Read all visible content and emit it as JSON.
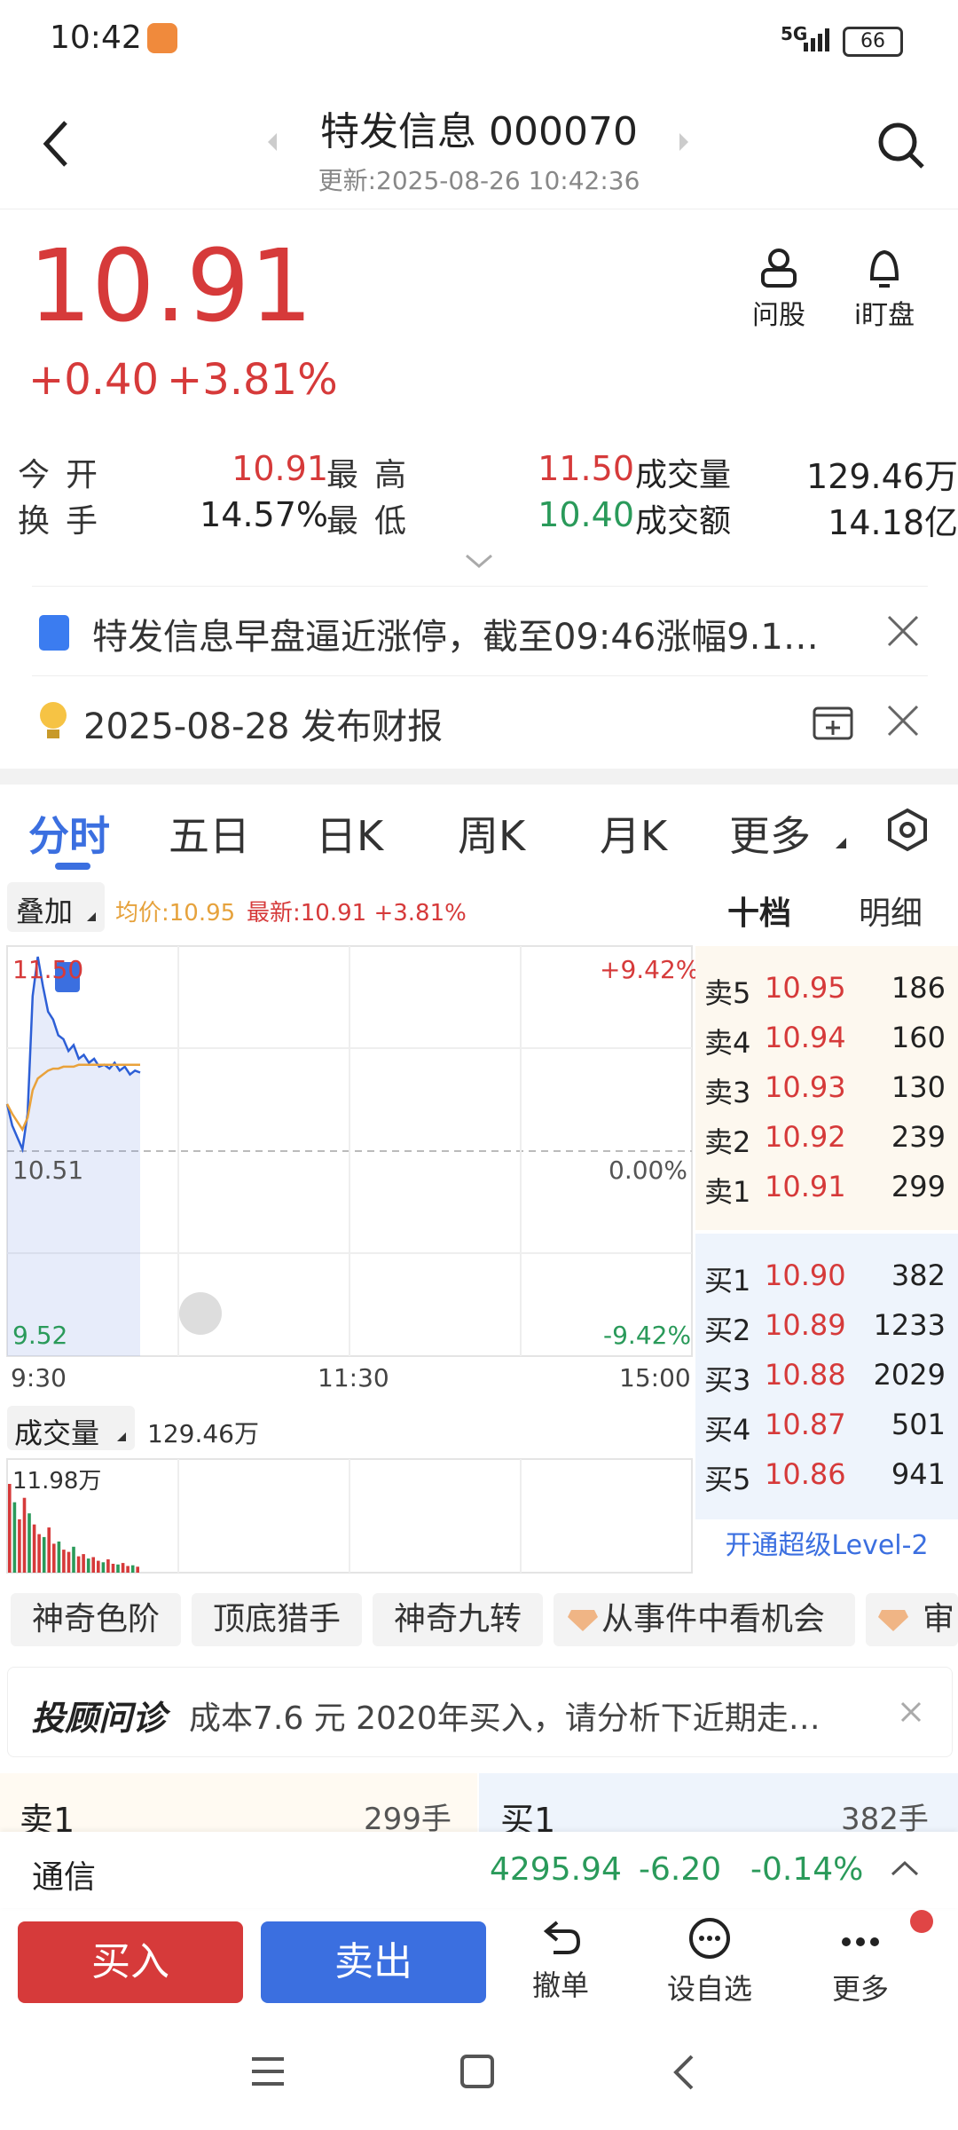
{
  "status": {
    "time": "10:42",
    "network": "5G",
    "battery": "66"
  },
  "header": {
    "title": "特发信息 000070",
    "updated": "更新:2025-08-26 10:42:36"
  },
  "quote": {
    "price": "10.91",
    "change": "+0.40",
    "change_pct": "+3.81%",
    "ask_label": "问股",
    "watch_label": "i盯盘",
    "stats": [
      {
        "label": "今开",
        "value": "10.91",
        "color": "red"
      },
      {
        "label": "最高",
        "value": "11.50",
        "color": "red"
      },
      {
        "label": "成交量",
        "value": "129.46万",
        "color": "black"
      },
      {
        "label": "换手",
        "value": "14.57%",
        "color": "black"
      },
      {
        "label": "最低",
        "value": "10.40",
        "color": "green"
      },
      {
        "label": "成交额",
        "value": "14.18亿",
        "color": "black"
      }
    ]
  },
  "news": {
    "headline": "特发信息早盘逼近涨停，截至09:46涨幅9.1…",
    "event": "2025-08-28 发布财报"
  },
  "tabs": [
    "分时",
    "五日",
    "日K",
    "周K",
    "月K",
    "更多"
  ],
  "chart_toolbar": {
    "overlay": "叠加",
    "avg": "均价:10.95",
    "latest": "最新:10.91 +3.81%",
    "depth_tab": "十档",
    "detail_tab": "明细"
  },
  "chart_labels": {
    "high": "11.50",
    "mid": "10.51",
    "low": "9.52",
    "pct_high": "+9.42%",
    "pct_mid": "0.00%",
    "pct_low": "-9.42%",
    "t_start": "9:30",
    "t_mid": "11:30",
    "t_end": "15:00",
    "vol_label": "成交量",
    "vol_total": "129.46万",
    "vol_max": "11.98万"
  },
  "chart_data": {
    "type": "line",
    "series": [
      {
        "values": [
          10.75,
          10.64,
          10.58,
          10.52,
          10.7,
          11.3,
          11.5,
          11.35,
          11.22,
          11.18,
          11.1,
          11.08,
          11.02,
          11.05,
          10.98,
          11.0,
          10.96,
          10.98,
          10.94,
          10.95,
          10.93,
          10.96,
          10.92,
          10.94,
          10.9,
          10.92,
          10.91
        ]
      },
      {
        "values": [
          10.75,
          10.7,
          10.66,
          10.62,
          10.68,
          10.82,
          10.88,
          10.9,
          10.92,
          10.93,
          10.93,
          10.94,
          10.94,
          10.94,
          10.95,
          10.95,
          10.95,
          10.95,
          10.95,
          10.95,
          10.95,
          10.95,
          10.95,
          10.95,
          10.95,
          10.95,
          10.95
        ]
      }
    ],
    "ylim": [
      9.52,
      11.5
    ],
    "volume": [
      11.98,
      9.5,
      7.2,
      10.1,
      8.0,
      6.5,
      5.2,
      4.8,
      6.1,
      3.9,
      4.2,
      3.1,
      2.8,
      3.5,
      2.2,
      2.5,
      1.9,
      2.1,
      1.6,
      1.4,
      1.8,
      1.2,
      1.1,
      1.3,
      0.9,
      1.0,
      0.8
    ]
  },
  "order_book": {
    "asks": [
      {
        "label": "卖5",
        "price": "10.95",
        "qty": "186"
      },
      {
        "label": "卖4",
        "price": "10.94",
        "qty": "160"
      },
      {
        "label": "卖3",
        "price": "10.93",
        "qty": "130"
      },
      {
        "label": "卖2",
        "price": "10.92",
        "qty": "239"
      },
      {
        "label": "卖1",
        "price": "10.91",
        "qty": "299"
      }
    ],
    "bids": [
      {
        "label": "买1",
        "price": "10.90",
        "qty": "382"
      },
      {
        "label": "买2",
        "price": "10.89",
        "qty": "1233"
      },
      {
        "label": "买3",
        "price": "10.88",
        "qty": "2029"
      },
      {
        "label": "买4",
        "price": "10.87",
        "qty": "501"
      },
      {
        "label": "买5",
        "price": "10.86",
        "qty": "941"
      }
    ],
    "level2_link": "开通超级Level-2"
  },
  "chips": [
    "神奇色阶",
    "顶底猎手",
    "神奇九转",
    "从事件中看机会",
    "审"
  ],
  "advisor": {
    "brand": "投顾问诊",
    "text": "成本7.6 元 2020年买入，请分析下近期走…"
  },
  "summary": {
    "sell_label": "卖1",
    "sell_qty": "299手",
    "buy_label": "买1",
    "buy_qty": "382手"
  },
  "index_bar": {
    "name": "通信",
    "value": "4295.94",
    "change": "-6.20",
    "pct": "-0.14%"
  },
  "bottom": {
    "buy": "买入",
    "sell": "卖出",
    "cancel": "撤单",
    "watch": "设自选",
    "more": "更多"
  }
}
